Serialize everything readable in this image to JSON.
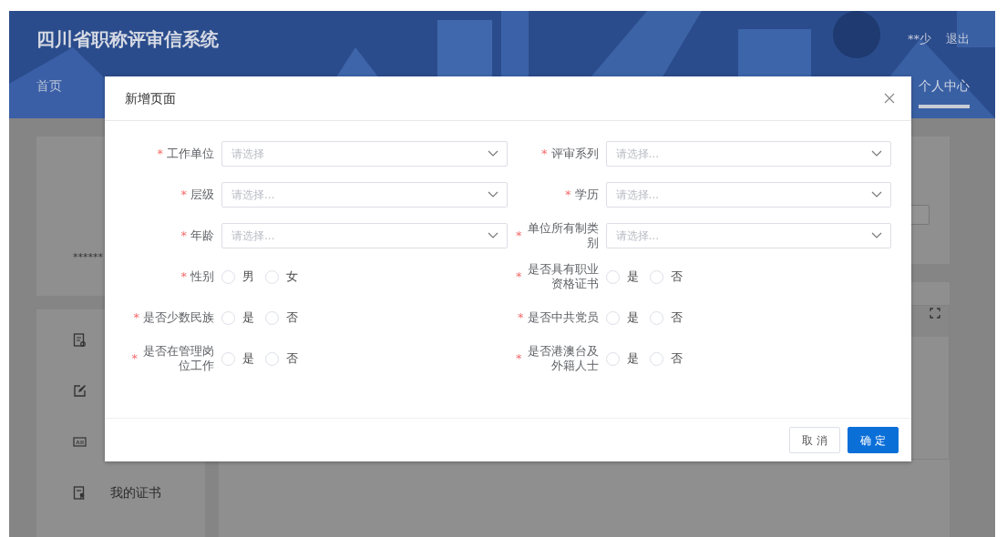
{
  "header": {
    "title": "四川省职称评审信系统",
    "user": "**少",
    "logout": "退出",
    "nav": [
      {
        "label": "首页",
        "selected": false
      },
      {
        "label": "个人中心",
        "selected": true
      }
    ]
  },
  "background": {
    "masked_name": "******",
    "sidebar_items": [
      {
        "kind": "icon_only"
      },
      {
        "kind": "icon_only"
      },
      {
        "kind": "icon_only"
      },
      {
        "kind": "labeled",
        "label": "我的证书"
      }
    ]
  },
  "dialog": {
    "title": "新增页面",
    "fields": [
      {
        "kind": "select",
        "label": "工作单位",
        "required_mark": "*",
        "placeholder": "请选择"
      },
      {
        "kind": "select",
        "label": "评审系列",
        "required_mark": "*",
        "placeholder": "请选择..."
      },
      {
        "kind": "select",
        "label": "层级",
        "required_mark": "*",
        "placeholder": "请选择..."
      },
      {
        "kind": "select",
        "label": "学历",
        "required_mark": "*",
        "placeholder": "请选择..."
      },
      {
        "kind": "select",
        "label": "年龄",
        "required_mark": "*",
        "placeholder": "请选择..."
      },
      {
        "kind": "select",
        "label": "单位所有制类别",
        "required_mark": "*",
        "placeholder": "请选择..."
      },
      {
        "kind": "radio",
        "label": "性别",
        "required_mark": "*",
        "options": [
          {
            "label": "男",
            "selected": false
          },
          {
            "label": "女",
            "selected": false
          }
        ]
      },
      {
        "kind": "radio",
        "label": "是否具有职业资格证书",
        "required_mark": "*",
        "options": [
          {
            "label": "是",
            "selected": false
          },
          {
            "label": "否",
            "selected": false
          }
        ]
      },
      {
        "kind": "radio",
        "label": "是否少数民族",
        "required_mark": "*",
        "options": [
          {
            "label": "是",
            "selected": false
          },
          {
            "label": "否",
            "selected": false
          }
        ]
      },
      {
        "kind": "radio",
        "label": "是否中共党员",
        "required_mark": "*",
        "options": [
          {
            "label": "是",
            "selected": false
          },
          {
            "label": "否",
            "selected": false
          }
        ]
      },
      {
        "kind": "radio",
        "label": "是否在管理岗位工作",
        "required_mark": "*",
        "options": [
          {
            "label": "是",
            "selected": false
          },
          {
            "label": "否",
            "selected": false
          }
        ]
      },
      {
        "kind": "radio",
        "label": "是否港澳台及外籍人士",
        "required_mark": "*",
        "options": [
          {
            "label": "是",
            "selected": false
          },
          {
            "label": "否",
            "selected": false
          }
        ]
      }
    ],
    "buttons": [
      {
        "kind": "secondary",
        "label": "取 消"
      },
      {
        "kind": "primary",
        "label": "确 定"
      }
    ]
  }
}
